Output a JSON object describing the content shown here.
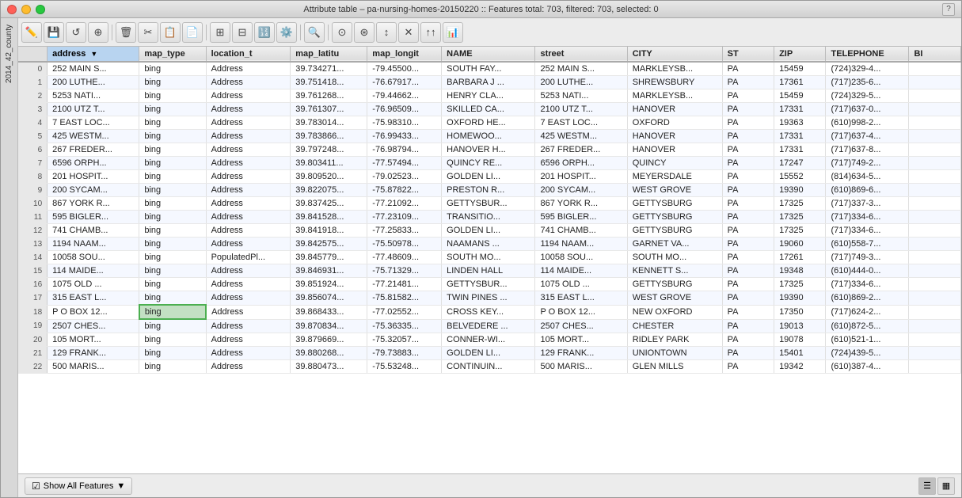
{
  "window": {
    "sidebar_label": "2014_42_county",
    "title": "Attribute table – pa-nursing-homes-20150220 :: Features total: 703, filtered: 703, selected: 0"
  },
  "toolbar": {
    "buttons": [
      {
        "name": "edit-pencil",
        "icon": "✏️"
      },
      {
        "name": "save",
        "icon": "💾"
      },
      {
        "name": "delete",
        "icon": "🗑️"
      },
      {
        "name": "duplicate",
        "icon": "📋"
      },
      {
        "name": "new-column",
        "icon": "⊞"
      },
      {
        "name": "delete-column",
        "icon": "⊟"
      },
      {
        "name": "calculator",
        "icon": "🔢"
      },
      {
        "name": "field-calc",
        "icon": "⚙️"
      },
      {
        "name": "search",
        "icon": "🔍"
      },
      {
        "name": "zoom-to-selection",
        "icon": "🔎"
      },
      {
        "name": "pan-to-selection",
        "icon": "✋"
      },
      {
        "name": "invert",
        "icon": "↕"
      },
      {
        "name": "deselect",
        "icon": "✕"
      },
      {
        "name": "move-selection",
        "icon": "↗"
      }
    ],
    "question": "?"
  },
  "table": {
    "columns": [
      {
        "id": "row_num",
        "label": ""
      },
      {
        "id": "address",
        "label": "address",
        "active": true
      },
      {
        "id": "map_type",
        "label": "map_type"
      },
      {
        "id": "location_t",
        "label": "location_t"
      },
      {
        "id": "map_latitu",
        "label": "map_latitu"
      },
      {
        "id": "map_longit",
        "label": "map_longit"
      },
      {
        "id": "NAME",
        "label": "NAME"
      },
      {
        "id": "street",
        "label": "street"
      },
      {
        "id": "CITY",
        "label": "CITY"
      },
      {
        "id": "ST",
        "label": "ST"
      },
      {
        "id": "ZIP",
        "label": "ZIP"
      },
      {
        "id": "TELEPHONE",
        "label": "TELEPHONE"
      },
      {
        "id": "BI",
        "label": "BI"
      }
    ],
    "rows": [
      {
        "row_num": "0",
        "address": "252 MAIN S...",
        "map_type": "bing",
        "location_t": "Address",
        "map_latitu": "39.734271...",
        "map_longit": "-79.45500...",
        "NAME": "SOUTH FAY...",
        "street": "252 MAIN S...",
        "CITY": "MARKLEYSB...",
        "ST": "PA",
        "ZIP": "15459",
        "TELEPHONE": "(724)329-4...",
        "BI": ""
      },
      {
        "row_num": "1",
        "address": "200 LUTHE...",
        "map_type": "bing",
        "location_t": "Address",
        "map_latitu": "39.751418...",
        "map_longit": "-76.67917...",
        "NAME": "BARBARA J ...",
        "street": "200 LUTHE...",
        "CITY": "SHREWSBURY",
        "ST": "PA",
        "ZIP": "17361",
        "TELEPHONE": "(717)235-6...",
        "BI": ""
      },
      {
        "row_num": "2",
        "address": "5253 NATI...",
        "map_type": "bing",
        "location_t": "Address",
        "map_latitu": "39.761268...",
        "map_longit": "-79.44662...",
        "NAME": "HENRY CLA...",
        "street": "5253 NATI...",
        "CITY": "MARKLEYSB...",
        "ST": "PA",
        "ZIP": "15459",
        "TELEPHONE": "(724)329-5...",
        "BI": ""
      },
      {
        "row_num": "3",
        "address": "2100 UTZ T...",
        "map_type": "bing",
        "location_t": "Address",
        "map_latitu": "39.761307...",
        "map_longit": "-76.96509...",
        "NAME": "SKILLED CA...",
        "street": "2100 UTZ T...",
        "CITY": "HANOVER",
        "ST": "PA",
        "ZIP": "17331",
        "TELEPHONE": "(717)637-0...",
        "BI": ""
      },
      {
        "row_num": "4",
        "address": "7 EAST LOC...",
        "map_type": "bing",
        "location_t": "Address",
        "map_latitu": "39.783014...",
        "map_longit": "-75.98310...",
        "NAME": "OXFORD HE...",
        "street": "7 EAST LOC...",
        "CITY": "OXFORD",
        "ST": "PA",
        "ZIP": "19363",
        "TELEPHONE": "(610)998-2...",
        "BI": ""
      },
      {
        "row_num": "5",
        "address": "425 WESTM...",
        "map_type": "bing",
        "location_t": "Address",
        "map_latitu": "39.783866...",
        "map_longit": "-76.99433...",
        "NAME": "HOMEWOO...",
        "street": "425 WESTM...",
        "CITY": "HANOVER",
        "ST": "PA",
        "ZIP": "17331",
        "TELEPHONE": "(717)637-4...",
        "BI": ""
      },
      {
        "row_num": "6",
        "address": "267 FREDER...",
        "map_type": "bing",
        "location_t": "Address",
        "map_latitu": "39.797248...",
        "map_longit": "-76.98794...",
        "NAME": "HANOVER H...",
        "street": "267 FREDER...",
        "CITY": "HANOVER",
        "ST": "PA",
        "ZIP": "17331",
        "TELEPHONE": "(717)637-8...",
        "BI": ""
      },
      {
        "row_num": "7",
        "address": "6596 ORPH...",
        "map_type": "bing",
        "location_t": "Address",
        "map_latitu": "39.803411...",
        "map_longit": "-77.57494...",
        "NAME": "QUINCY RE...",
        "street": "6596 ORPH...",
        "CITY": "QUINCY",
        "ST": "PA",
        "ZIP": "17247",
        "TELEPHONE": "(717)749-2...",
        "BI": ""
      },
      {
        "row_num": "8",
        "address": "201 HOSPIT...",
        "map_type": "bing",
        "location_t": "Address",
        "map_latitu": "39.809520...",
        "map_longit": "-79.02523...",
        "NAME": "GOLDEN LI...",
        "street": "201 HOSPIT...",
        "CITY": "MEYERSDALE",
        "ST": "PA",
        "ZIP": "15552",
        "TELEPHONE": "(814)634-5...",
        "BI": ""
      },
      {
        "row_num": "9",
        "address": "200 SYCAM...",
        "map_type": "bing",
        "location_t": "Address",
        "map_latitu": "39.822075...",
        "map_longit": "-75.87822...",
        "NAME": "PRESTON R...",
        "street": "200 SYCAM...",
        "CITY": "WEST GROVE",
        "ST": "PA",
        "ZIP": "19390",
        "TELEPHONE": "(610)869-6...",
        "BI": ""
      },
      {
        "row_num": "10",
        "address": "867 YORK R...",
        "map_type": "bing",
        "location_t": "Address",
        "map_latitu": "39.837425...",
        "map_longit": "-77.21092...",
        "NAME": "GETTYSBUR...",
        "street": "867 YORK R...",
        "CITY": "GETTYSBURG",
        "ST": "PA",
        "ZIP": "17325",
        "TELEPHONE": "(717)337-3...",
        "BI": ""
      },
      {
        "row_num": "11",
        "address": "595 BIGLER...",
        "map_type": "bing",
        "location_t": "Address",
        "map_latitu": "39.841528...",
        "map_longit": "-77.23109...",
        "NAME": "TRANSITIO...",
        "street": "595 BIGLER...",
        "CITY": "GETTYSBURG",
        "ST": "PA",
        "ZIP": "17325",
        "TELEPHONE": "(717)334-6...",
        "BI": ""
      },
      {
        "row_num": "12",
        "address": "741 CHAMB...",
        "map_type": "bing",
        "location_t": "Address",
        "map_latitu": "39.841918...",
        "map_longit": "-77.25833...",
        "NAME": "GOLDEN LI...",
        "street": "741 CHAMB...",
        "CITY": "GETTYSBURG",
        "ST": "PA",
        "ZIP": "17325",
        "TELEPHONE": "(717)334-6...",
        "BI": ""
      },
      {
        "row_num": "13",
        "address": "1194 NAAM...",
        "map_type": "bing",
        "location_t": "Address",
        "map_latitu": "39.842575...",
        "map_longit": "-75.50978...",
        "NAME": "NAAMANS ...",
        "street": "1194 NAAM...",
        "CITY": "GARNET VA...",
        "ST": "PA",
        "ZIP": "19060",
        "TELEPHONE": "(610)558-7...",
        "BI": ""
      },
      {
        "row_num": "14",
        "address": "10058 SOU...",
        "map_type": "bing",
        "location_t": "PopulatedPl...",
        "map_latitu": "39.845779...",
        "map_longit": "-77.48609...",
        "NAME": "SOUTH MO...",
        "street": "10058 SOU...",
        "CITY": "SOUTH MO...",
        "ST": "PA",
        "ZIP": "17261",
        "TELEPHONE": "(717)749-3...",
        "BI": ""
      },
      {
        "row_num": "15",
        "address": "114 MAIDE...",
        "map_type": "bing",
        "location_t": "Address",
        "map_latitu": "39.846931...",
        "map_longit": "-75.71329...",
        "NAME": "LINDEN HALL",
        "street": "114 MAIDE...",
        "CITY": "KENNETT S...",
        "ST": "PA",
        "ZIP": "19348",
        "TELEPHONE": "(610)444-0...",
        "BI": ""
      },
      {
        "row_num": "16",
        "address": "1075 OLD ...",
        "map_type": "bing",
        "location_t": "Address",
        "map_latitu": "39.851924...",
        "map_longit": "-77.21481...",
        "NAME": "GETTYSBUR...",
        "street": "1075 OLD ...",
        "CITY": "GETTYSBURG",
        "ST": "PA",
        "ZIP": "17325",
        "TELEPHONE": "(717)334-6...",
        "BI": ""
      },
      {
        "row_num": "17",
        "address": "315 EAST L...",
        "map_type": "bing",
        "location_t": "Address",
        "map_latitu": "39.856074...",
        "map_longit": "-75.81582...",
        "NAME": "TWIN PINES ...",
        "street": "315 EAST L...",
        "CITY": "WEST GROVE",
        "ST": "PA",
        "ZIP": "19390",
        "TELEPHONE": "(610)869-2...",
        "BI": ""
      },
      {
        "row_num": "18",
        "address": "P O BOX 12...",
        "map_type": "bing",
        "location_t": "Address",
        "map_latitu": "39.868433...",
        "map_longit": "-77.02552...",
        "NAME": "CROSS KEY...",
        "street": "P O BOX 12...",
        "CITY": "NEW OXFORD",
        "ST": "PA",
        "ZIP": "17350",
        "TELEPHONE": "(717)624-2...",
        "BI": "",
        "selected_col": "map_type"
      },
      {
        "row_num": "19",
        "address": "2507 CHES...",
        "map_type": "bing",
        "location_t": "Address",
        "map_latitu": "39.870834...",
        "map_longit": "-75.36335...",
        "NAME": "BELVEDERE ...",
        "street": "2507 CHES...",
        "CITY": "CHESTER",
        "ST": "PA",
        "ZIP": "19013",
        "TELEPHONE": "(610)872-5...",
        "BI": ""
      },
      {
        "row_num": "20",
        "address": "105 MORT...",
        "map_type": "bing",
        "location_t": "Address",
        "map_latitu": "39.879669...",
        "map_longit": "-75.32057...",
        "NAME": "CONNER-WI...",
        "street": "105 MORT...",
        "CITY": "RIDLEY PARK",
        "ST": "PA",
        "ZIP": "19078",
        "TELEPHONE": "(610)521-1...",
        "BI": ""
      },
      {
        "row_num": "21",
        "address": "129 FRANK...",
        "map_type": "bing",
        "location_t": "Address",
        "map_latitu": "39.880268...",
        "map_longit": "-79.73883...",
        "NAME": "GOLDEN LI...",
        "street": "129 FRANK...",
        "CITY": "UNIONTOWN",
        "ST": "PA",
        "ZIP": "15401",
        "TELEPHONE": "(724)439-5...",
        "BI": ""
      },
      {
        "row_num": "22",
        "address": "500 MARIS...",
        "map_type": "bing",
        "location_t": "Address",
        "map_latitu": "39.880473...",
        "map_longit": "-75.53248...",
        "NAME": "CONTINUIN...",
        "street": "500 MARIS...",
        "CITY": "GLEN MILLS",
        "ST": "PA",
        "ZIP": "19342",
        "TELEPHONE": "(610)387-4...",
        "BI": ""
      }
    ]
  },
  "status_bar": {
    "show_features_label": "Show All Features",
    "dropdown_arrow": "▼"
  }
}
